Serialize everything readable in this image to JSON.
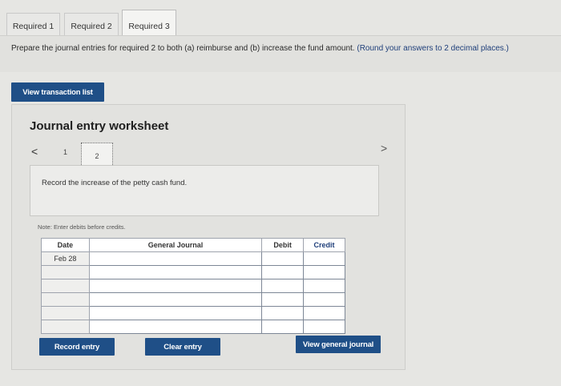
{
  "tabs": [
    {
      "label": "Required 1"
    },
    {
      "label": "Required 2"
    },
    {
      "label": "Required 3"
    }
  ],
  "instruction": {
    "main": "Prepare the journal entries for required 2 to both (a) reimburse and (b) increase the fund amount.",
    "note": "(Round your answers to 2 decimal places.)"
  },
  "view_transaction_button": "View transaction list",
  "worksheet": {
    "title": "Journal entry worksheet",
    "prev": "<",
    "next": ">",
    "pages": [
      "1",
      "2"
    ],
    "description": "Record the increase of the petty cash fund.",
    "note": "Note: Enter debits before credits.",
    "table": {
      "headers": {
        "date": "Date",
        "journal": "General Journal",
        "debit": "Debit",
        "credit": "Credit"
      },
      "rows": [
        {
          "date": "Feb 28",
          "journal": "",
          "debit": "",
          "credit": ""
        },
        {
          "date": "",
          "journal": "",
          "debit": "",
          "credit": ""
        },
        {
          "date": "",
          "journal": "",
          "debit": "",
          "credit": ""
        },
        {
          "date": "",
          "journal": "",
          "debit": "",
          "credit": ""
        },
        {
          "date": "",
          "journal": "",
          "debit": "",
          "credit": ""
        },
        {
          "date": "",
          "journal": "",
          "debit": "",
          "credit": ""
        }
      ]
    },
    "buttons": {
      "record": "Record entry",
      "clear": "Clear entry",
      "view_journal": "View general journal"
    }
  },
  "colors": {
    "button_bg": "#1f4f87",
    "background": "#e6e6e3"
  }
}
